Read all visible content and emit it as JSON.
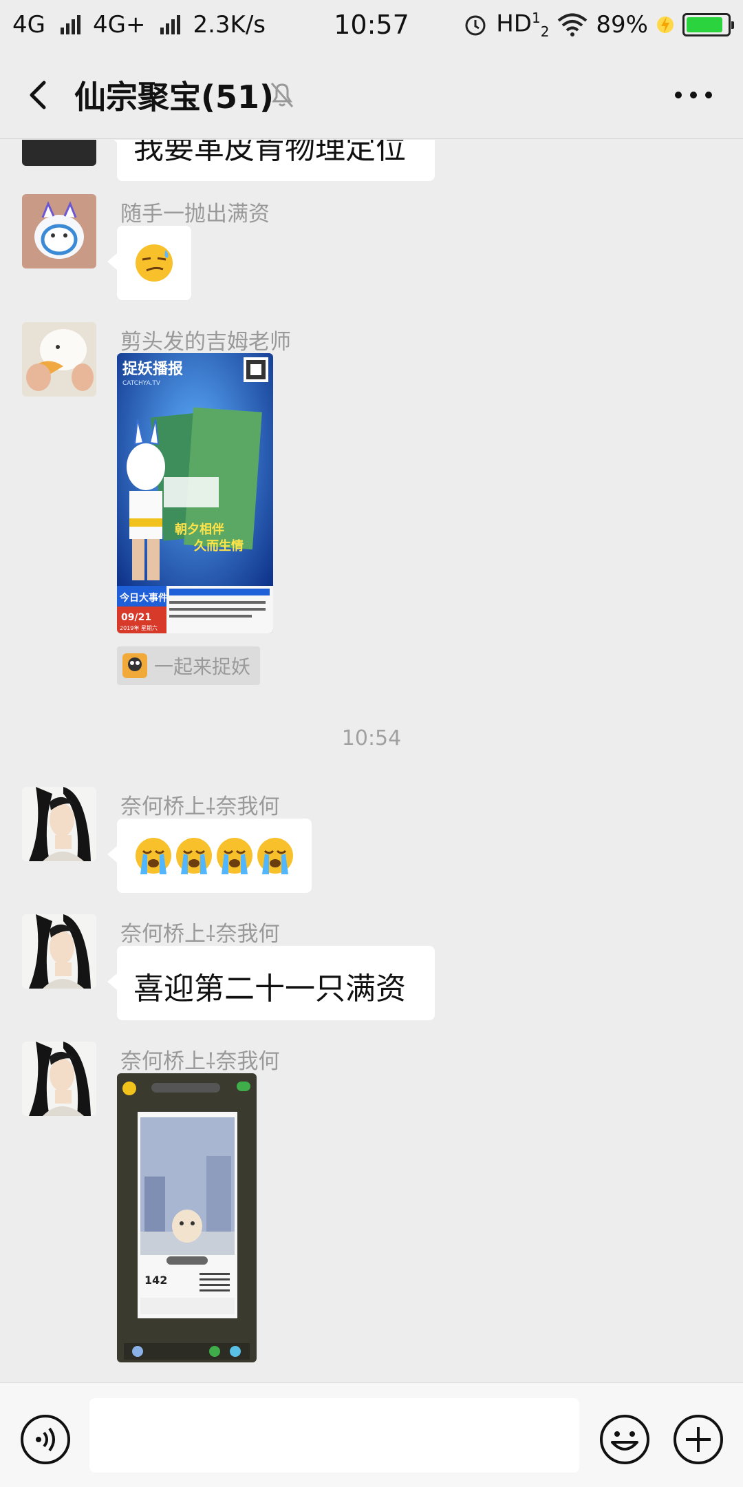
{
  "status_bar": {
    "network1": "4G",
    "network2": "4G+",
    "speed": "2.3K/s",
    "time": "10:57",
    "hd": "HD",
    "battery": "89%",
    "battery_level": 0.89,
    "battery_color": "#2bd33e"
  },
  "header": {
    "title": "仙宗聚宝(51)",
    "back_icon": "chevron-left-icon",
    "mute_icon": "bell-off-icon",
    "more_icon": "more-icon"
  },
  "messages": [
    {
      "type": "text",
      "text": "我要革皮肯物理定位"
    },
    {
      "type": "emoji",
      "sender": "随手一抛出满资",
      "emoji": "smirk-sweat"
    },
    {
      "type": "image",
      "sender": "剪头发的吉姆老师",
      "image_text": {
        "logo": "捉妖播报",
        "sub": "CATCHYA.TV",
        "slogan1": "朝夕相伴",
        "slogan2": "久而生情",
        "event": "今日大事件",
        "date": "09/21",
        "year": "2019年 星期六"
      },
      "app_tag": "一起来捉妖"
    },
    {
      "type": "timestamp",
      "text": "10:54"
    },
    {
      "type": "emoji",
      "sender": "奈何桥上⸸奈我何",
      "emoji": "crying-x4"
    },
    {
      "type": "text",
      "sender": "奈何桥上⸸奈我何",
      "text": "喜迎第二十一只满资"
    },
    {
      "type": "image",
      "sender": "奈何桥上⸸奈我何",
      "image_text": {
        "value": "142"
      }
    }
  ],
  "input_bar": {
    "voice_icon": "voice-icon",
    "emoji_icon": "emoji-icon",
    "plus_icon": "plus-icon"
  },
  "colors": {
    "background": "#ededed",
    "bubble": "#ffffff",
    "sender_name": "#999999"
  }
}
